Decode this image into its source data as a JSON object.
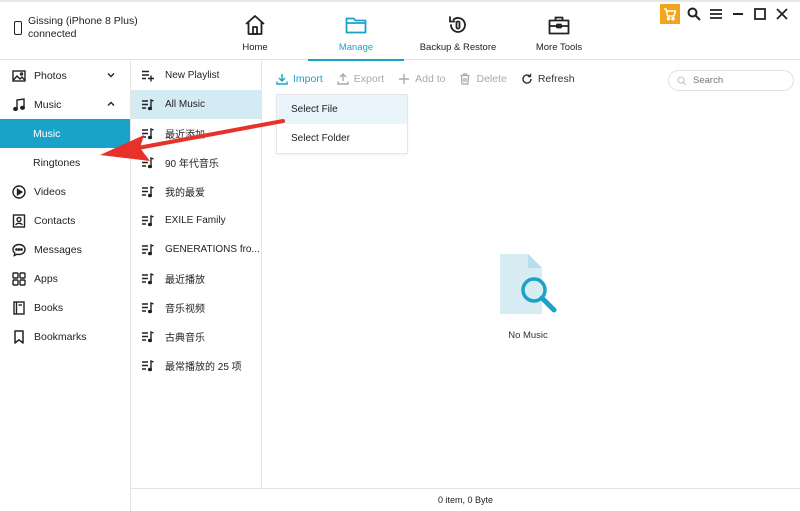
{
  "device": {
    "name": "Gissing (iPhone 8 Plus)",
    "status": "connected"
  },
  "nav": {
    "tabs": [
      {
        "label": "Home",
        "icon": "home-icon"
      },
      {
        "label": "Manage",
        "icon": "folder-icon",
        "active": true
      },
      {
        "label": "Backup & Restore",
        "icon": "backup-restore-icon"
      },
      {
        "label": "More Tools",
        "icon": "toolbox-icon"
      }
    ]
  },
  "window_controls": [
    "cart-icon",
    "search-icon",
    "menu-icon",
    "minimize-icon",
    "maximize-icon",
    "close-icon"
  ],
  "sidebar": {
    "items": [
      {
        "label": "Photos",
        "icon": "photo-icon"
      },
      {
        "label": "Music",
        "icon": "music-note-icon"
      },
      {
        "label": "Music",
        "sub": true,
        "selected": true
      },
      {
        "label": "Ringtones",
        "sub": true
      },
      {
        "label": "Videos",
        "icon": "play-icon"
      },
      {
        "label": "Contacts",
        "icon": "contacts-icon"
      },
      {
        "label": "Messages",
        "icon": "chat-icon"
      },
      {
        "label": "Apps",
        "icon": "apps-grid-icon"
      },
      {
        "label": "Books",
        "icon": "book-icon"
      },
      {
        "label": "Bookmarks",
        "icon": "bookmark-icon"
      }
    ]
  },
  "playlists": {
    "new_label": "New Playlist",
    "items": [
      "All Music",
      "最近添加",
      "90 年代音乐",
      "我的最爱",
      "EXILE Family",
      "GENERATIONS fro...",
      "最近播放",
      "音乐视频",
      "古典音乐",
      "最常播放的 25 项"
    ]
  },
  "toolbar": {
    "import": "Import",
    "export": "Export",
    "add_to": "Add to",
    "delete": "Delete",
    "refresh": "Refresh",
    "search_placeholder": "Search"
  },
  "import_menu": {
    "items": [
      "Select File",
      "Select Folder"
    ]
  },
  "empty_state": {
    "message": "No Music"
  },
  "status": {
    "text": "0 item, 0 Byte"
  },
  "colors": {
    "accent": "#1aa3c8",
    "selected_light": "#d3ecf4",
    "cart": "#f2a51a",
    "arrow": "#e8312a"
  }
}
